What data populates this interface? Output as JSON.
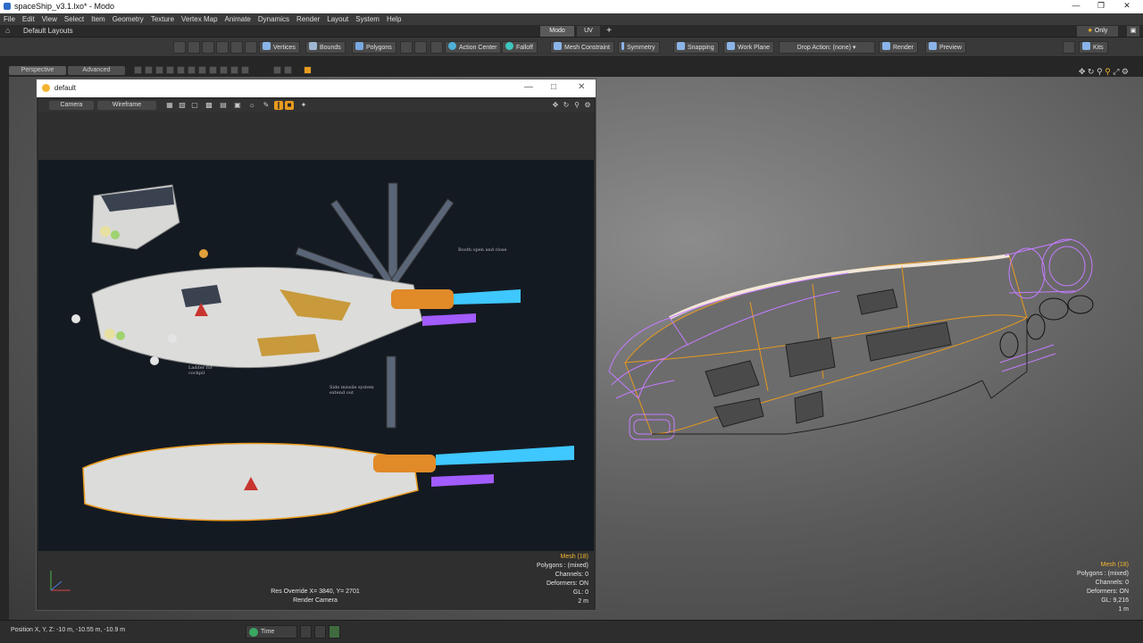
{
  "window": {
    "title": "spaceShip_v3.1.lxo* - Modo"
  },
  "menu": [
    "File",
    "Edit",
    "View",
    "Select",
    "Item",
    "Geometry",
    "Texture",
    "Vertex Map",
    "Animate",
    "Dynamics",
    "Render",
    "Layout",
    "System",
    "Help"
  ],
  "layout": {
    "label": "Default Layouts",
    "tabs": [
      "Modo",
      "UV"
    ],
    "add": "+",
    "only_label": "Only"
  },
  "toolbar": {
    "vertices": "Vertices",
    "bounds": "Bounds",
    "polygons": "Polygons",
    "action_center": "Action Center",
    "falloff": "Falloff",
    "mesh_constraint": "Mesh Constraint",
    "symmetry": "Symmetry",
    "snapping": "Snapping",
    "work_plane": "Work Plane",
    "drop_action": "Drop Action: (none)",
    "render": "Render",
    "preview": "Preview",
    "kits": "Kits"
  },
  "viewport": {
    "mode_tabs": [
      "Perspective",
      "Advanced"
    ],
    "info": {
      "mesh": "Mesh (18)",
      "polygons": "Polygons : (mixed)",
      "channels": "Channels: 0",
      "deformers": "Deformers: ON",
      "gl": "GL: 9,216",
      "scale": "1 m"
    }
  },
  "render_window": {
    "title": "default",
    "camera_btn": "Camera",
    "wireframe_btn": "Wireframe",
    "info": {
      "mesh": "Mesh (18)",
      "polygons": "Polygons : (mixed)",
      "channels": "Channels: 0",
      "deformers": "Deformers: ON",
      "gl": "GL: 0",
      "scale": "2 m"
    },
    "res_override": "Res Override  X= 3840, Y= 2701",
    "render_camera": "Render Camera",
    "annotations": [
      "Booth open and close",
      "Ladder for cockpit",
      "Side missile system extend out"
    ]
  },
  "status": {
    "position": "Position X, Y, Z:  -10 m, -10.55 m, -10.9 m",
    "time_btn": "Time"
  },
  "colors": {
    "accent": "#f3b531",
    "wireframe": "#c47cff",
    "selection_edge": "#e89a1e",
    "thruster": "#3fc7ff"
  }
}
